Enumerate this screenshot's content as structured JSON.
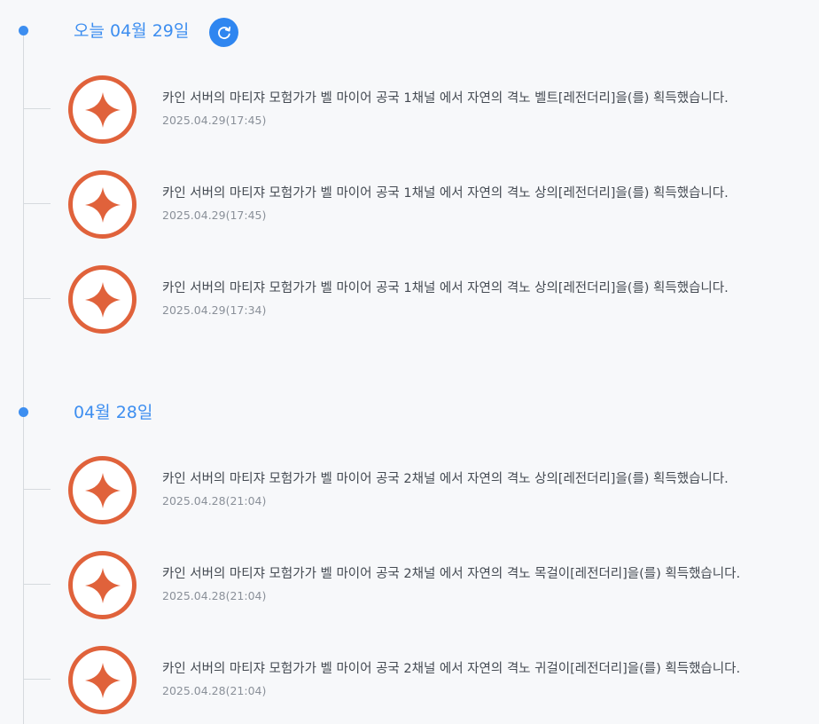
{
  "accent_color": "#3d8ef0",
  "badge_color": "#e0623b",
  "groups": [
    {
      "date_label": "오늘 04월 29일",
      "refresh_icon": "refresh-icon",
      "items": [
        {
          "icon": "sparkle-icon",
          "message": "카인 서버의 마티쟈 모험가가 벨 마이어 공국 1채널 에서 자연의 격노 벨트[레전더리]을(를) 획득했습니다.",
          "time": "2025.04.29(17:45)"
        },
        {
          "icon": "sparkle-icon",
          "message": "카인 서버의 마티쟈 모험가가 벨 마이어 공국 1채널 에서 자연의 격노 상의[레전더리]을(를) 획득했습니다.",
          "time": "2025.04.29(17:45)"
        },
        {
          "icon": "sparkle-icon",
          "message": "카인 서버의 마티쟈 모험가가 벨 마이어 공국 1채널 에서 자연의 격노 상의[레전더리]을(를) 획득했습니다.",
          "time": "2025.04.29(17:34)"
        }
      ]
    },
    {
      "date_label": "04월 28일",
      "items": [
        {
          "icon": "sparkle-icon",
          "message": "카인 서버의 마티쟈 모험가가 벨 마이어 공국 2채널 에서 자연의 격노 상의[레전더리]을(를) 획득했습니다.",
          "time": "2025.04.28(21:04)"
        },
        {
          "icon": "sparkle-icon",
          "message": "카인 서버의 마티쟈 모험가가 벨 마이어 공국 2채널 에서 자연의 격노 목걸이[레전더리]을(를) 획득했습니다.",
          "time": "2025.04.28(21:04)"
        },
        {
          "icon": "sparkle-icon",
          "message": "카인 서버의 마티쟈 모험가가 벨 마이어 공국 2채널 에서 자연의 격노 귀걸이[레전더리]을(를) 획득했습니다.",
          "time": "2025.04.28(21:04)"
        }
      ]
    }
  ]
}
